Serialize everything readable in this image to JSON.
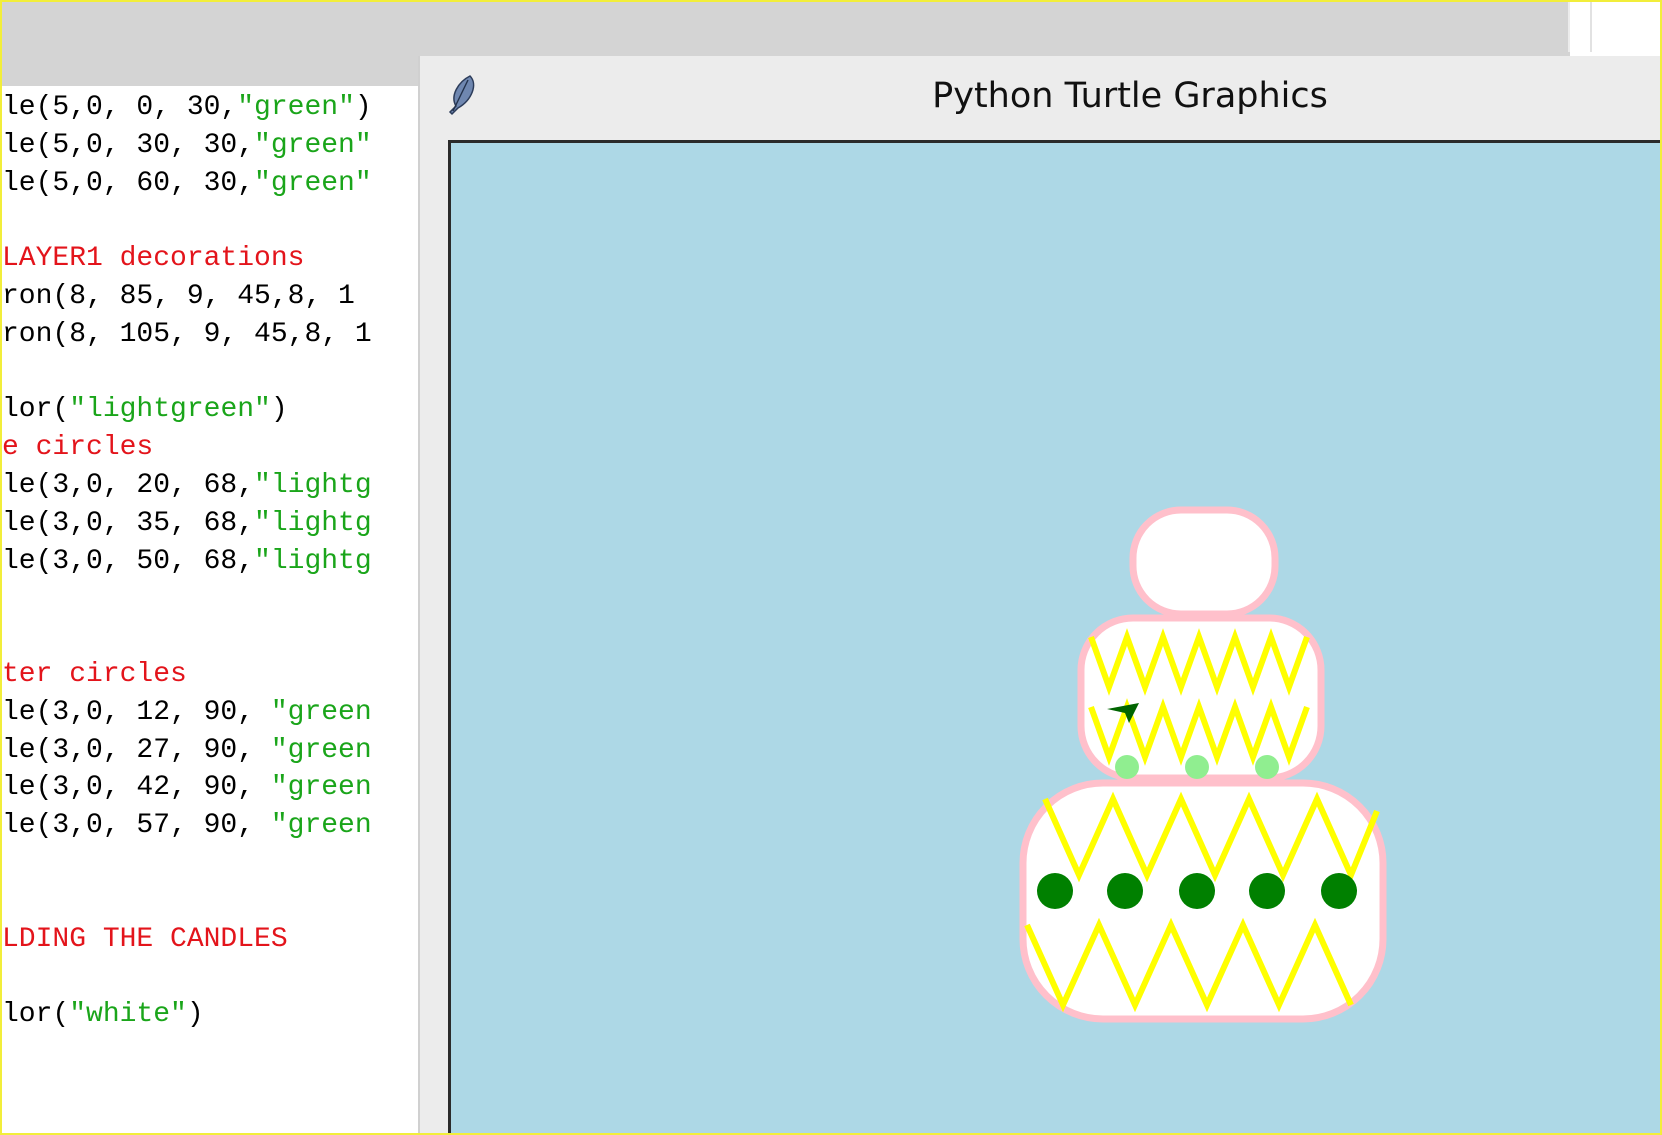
{
  "editor": {
    "lines": [
      [
        {
          "t": "le(5,0, 0, 30,",
          "c": "code"
        },
        {
          "t": "\"green\"",
          "c": "str"
        },
        {
          "t": ")",
          "c": "code"
        }
      ],
      [
        {
          "t": "le(5,0, 30, 30,",
          "c": "code"
        },
        {
          "t": "\"green\"",
          "c": "str"
        }
      ],
      [
        {
          "t": "le(5,0, 60, 30,",
          "c": "code"
        },
        {
          "t": "\"green\"",
          "c": "str"
        }
      ],
      [],
      [
        {
          "t": "LAYER1 decorations",
          "c": "cmt"
        }
      ],
      [
        {
          "t": "ron(8, 85, 9, 45,8, 1",
          "c": "code"
        }
      ],
      [
        {
          "t": "ron(8, 105, 9, 45,8, 1",
          "c": "code"
        }
      ],
      [],
      [
        {
          "t": "lor(",
          "c": "code"
        },
        {
          "t": "\"lightgreen\"",
          "c": "str"
        },
        {
          "t": ")",
          "c": "code"
        }
      ],
      [
        {
          "t": "e circles",
          "c": "cmt"
        }
      ],
      [
        {
          "t": "le(3,0, 20, 68,",
          "c": "code"
        },
        {
          "t": "\"lightg",
          "c": "str"
        }
      ],
      [
        {
          "t": "le(3,0, 35, 68,",
          "c": "code"
        },
        {
          "t": "\"lightg",
          "c": "str"
        }
      ],
      [
        {
          "t": "le(3,0, 50, 68,",
          "c": "code"
        },
        {
          "t": "\"lightg",
          "c": "str"
        }
      ],
      [],
      [],
      [
        {
          "t": "ter circles",
          "c": "cmt"
        }
      ],
      [
        {
          "t": "le(3,0, 12, 90, ",
          "c": "code"
        },
        {
          "t": "\"green",
          "c": "str"
        }
      ],
      [
        {
          "t": "le(3,0, 27, 90, ",
          "c": "code"
        },
        {
          "t": "\"green",
          "c": "str"
        }
      ],
      [
        {
          "t": "le(3,0, 42, 90, ",
          "c": "code"
        },
        {
          "t": "\"green",
          "c": "str"
        }
      ],
      [
        {
          "t": "le(3,0, 57, 90, ",
          "c": "code"
        },
        {
          "t": "\"green",
          "c": "str"
        }
      ],
      [],
      [],
      [
        {
          "t": "LDING THE CANDLES",
          "c": "cmt"
        }
      ],
      [],
      [
        {
          "t": "lor(",
          "c": "code"
        },
        {
          "t": "\"white\"",
          "c": "str"
        },
        {
          "t": ")",
          "c": "code"
        }
      ]
    ]
  },
  "turtle_window": {
    "title": "Python Turtle Graphics",
    "icon": "feather-icon",
    "canvas_background": "#add8e6",
    "cake": {
      "fill_color": "#ffffff",
      "outline_color": "#ffc0cb",
      "zigzag_color": "#ffff00",
      "dot_color": "#008000",
      "small_dot_color": "#90ee90",
      "turtle_color": "#006400",
      "tiers": [
        "top",
        "middle",
        "bottom"
      ],
      "bottom_dot_count": 5,
      "middle_dot_count": 3
    }
  },
  "colors": {
    "code_text": "#000000",
    "string": "#1aa51a",
    "comment": "#e3141b",
    "frame": "#f2ee3a"
  }
}
